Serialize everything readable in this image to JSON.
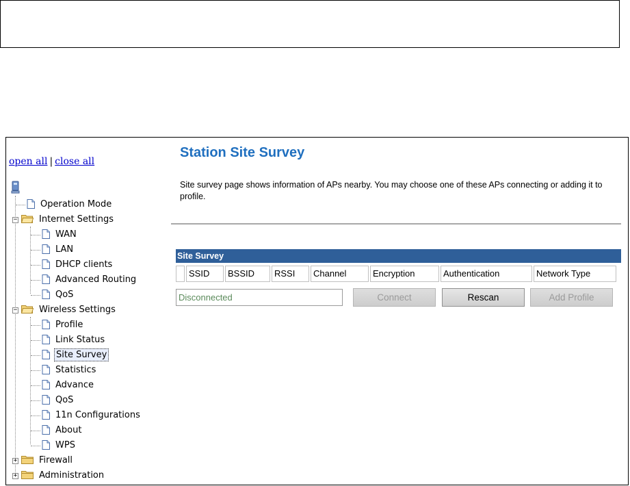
{
  "tree": {
    "open_all": "open all",
    "separator": "|",
    "close_all": "close all",
    "items": [
      {
        "label": "Operation Mode"
      },
      {
        "label": "Internet Settings"
      },
      {
        "label": "WAN"
      },
      {
        "label": "LAN"
      },
      {
        "label": "DHCP clients"
      },
      {
        "label": "Advanced Routing"
      },
      {
        "label": "QoS"
      },
      {
        "label": "Wireless Settings"
      },
      {
        "label": "Profile"
      },
      {
        "label": "Link Status"
      },
      {
        "label": "Site Survey"
      },
      {
        "label": "Statistics"
      },
      {
        "label": "Advance"
      },
      {
        "label": "QoS"
      },
      {
        "label": "11n Configurations"
      },
      {
        "label": "About"
      },
      {
        "label": "WPS"
      },
      {
        "label": "Firewall"
      },
      {
        "label": "Administration"
      }
    ],
    "selected": "Site Survey",
    "expander_open": "−",
    "expander_closed": "+"
  },
  "page": {
    "title": "Station Site Survey",
    "description": "Site survey page shows information of APs nearby. You may choose one of these APs connecting or adding it to profile."
  },
  "survey": {
    "header": "Site Survey",
    "columns": [
      "",
      "SSID",
      "BSSID",
      "RSSI",
      "Channel",
      "Encryption",
      "Authentication",
      "Network Type"
    ],
    "status_value": "Disconnected",
    "buttons": {
      "connect": "Connect",
      "rescan": "Rescan",
      "add_profile": "Add Profile"
    }
  },
  "colors": {
    "title": "#1f6fbf",
    "header_bg": "#2f5f99",
    "link": "#0000cc"
  }
}
